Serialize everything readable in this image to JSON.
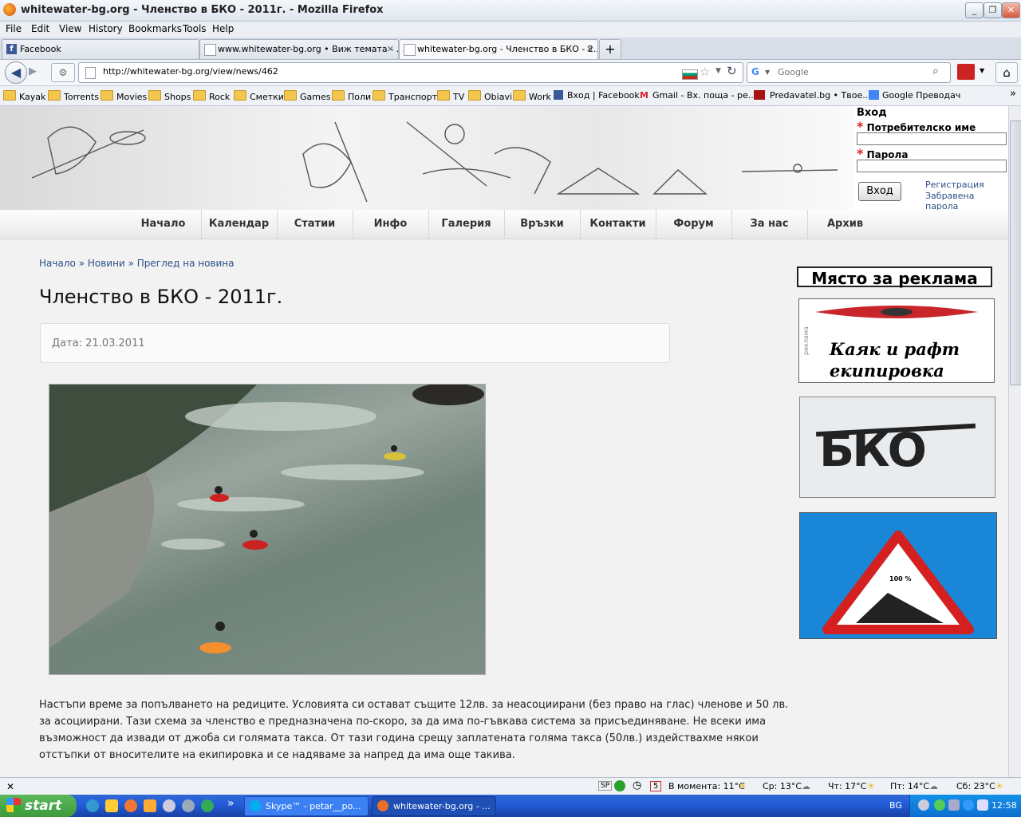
{
  "window": {
    "title": "whitewater-bg.org - Членство в БКО - 2011г. - Mozilla Firefox",
    "min": "_",
    "max": "❐",
    "close": "✕"
  },
  "menu": [
    "File",
    "Edit",
    "View",
    "History",
    "Bookmarks",
    "Tools",
    "Help"
  ],
  "tabs": [
    {
      "label": "Facebook",
      "close": "✕"
    },
    {
      "label": "www.whitewater-bg.org • Виж темата - ...",
      "close": "✕"
    },
    {
      "label": "whitewater-bg.org - Членство в БКО - 2...",
      "close": "✕"
    }
  ],
  "new_tab": "+",
  "nav": {
    "url": "http://whitewater-bg.org/view/news/462",
    "search_placeholder": "Google"
  },
  "bookmarks": [
    "Kayak",
    "Torrents",
    "Movies",
    "Shops",
    "Rock",
    "Сметки",
    "Games",
    "Поли",
    "Транспорт",
    "TV",
    "Obiavi",
    "Work",
    "Вход | Facebook",
    "Gmail - Вх. поща - ре...",
    "Predavatel.bg • Твое...",
    "Google Преводач"
  ],
  "login": {
    "title": "Вход",
    "username_label": "Потребителско име",
    "password_label": "Парола",
    "required_mark": "*",
    "submit": "Вход",
    "register": "Регистрация",
    "forgot": "Забравена парола"
  },
  "site_nav": [
    "Начало",
    "Календар",
    "Статии",
    "Инфо",
    "Галерия",
    "Връзки",
    "Контакти",
    "Форум",
    "За нас",
    "Архив"
  ],
  "breadcrumb": {
    "home": "Начало",
    "news": "Новини",
    "current": "Преглед на новина",
    "sep": "»"
  },
  "article": {
    "title": "Членство в БКО - 2011г.",
    "date": "Дата: 21.03.2011",
    "body": "Настъпи време за попълването на редиците. Условията си остават същите 12лв. за неасоциирани (без право на глас) членове и 50 лв. за асоциирани. Тази схема за членство е предназначена по-скоро, за да има по-гъвкава система за присъединяване. Не всеки има възможност да извади от джоба си голямата такса. От тази година срещу заплатената голяма такса (50лв.) издействахме някои отстъпки от вносителите на екипировка и се надяваме за напред да има още такива."
  },
  "ads": {
    "title": "Място за реклама",
    "ad1_text_1": "Каяк и рафт",
    "ad1_text_2": "екипировка",
    "ad1_side": "реклама",
    "ad2_logo": "БКО",
    "ad3_sign": "100 %"
  },
  "statusbar": {
    "close": "✕",
    "sp": "SP",
    "cal_day": "5",
    "weather_now": "В момента: 11°C",
    "weather_wed": "Ср: 13°C",
    "weather_thu": "Чт: 17°C",
    "weather_fri": "Пт: 14°C",
    "weather_sat": "Сб: 23°C"
  },
  "taskbar": {
    "start": "start",
    "chevron": "»",
    "task1": "Skype™ - petar__po...",
    "task2": "whitewater-bg.org - ...",
    "lang": "BG",
    "time": "12:58"
  },
  "colors": {
    "link": "#2a4f86",
    "taskbar": "#245edb",
    "start": "#3c9a3c",
    "required": "#dd2222",
    "ad_blue": "#1a86d8"
  }
}
